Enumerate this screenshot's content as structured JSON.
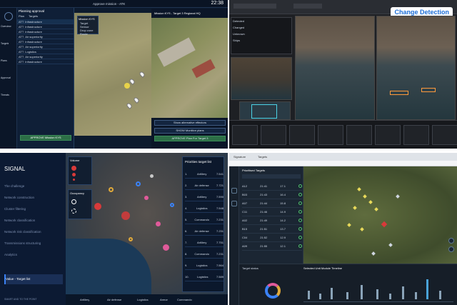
{
  "q1": {
    "top_title": "Approve mission - ATK",
    "time": "22:38",
    "panel_title": "Planning approval",
    "tabs": [
      "Plan",
      "Targets"
    ],
    "side_items": [
      "Overview",
      "Targets",
      "Plans",
      "Approval",
      "Threats"
    ],
    "rows": [
      {
        "id": "ATT",
        "text": "Infrastructure"
      },
      {
        "id": "ATT",
        "text": "Infrastructure"
      },
      {
        "id": "ATT",
        "text": "Infrastructure"
      },
      {
        "id": "ATT",
        "text": "Air superiority"
      },
      {
        "id": "ATT",
        "text": "Infrastructure"
      },
      {
        "id": "ATT",
        "text": "Air superiority"
      },
      {
        "id": "ATT",
        "text": "Logistics"
      },
      {
        "id": "ATT",
        "text": "Air superiority"
      },
      {
        "id": "ATT",
        "text": "Infrastructure"
      }
    ],
    "map_legend_title": "Mission KYS",
    "map_legend": [
      "Target",
      "Sensor",
      "Drop zone",
      "Route"
    ],
    "map2_title": "Mission KYS - Target 3 Regional HQ",
    "btn_show_alt": "Show alternative effectors",
    "btn_show_munitions": "SHOW Munition plans",
    "btn_approve": "APPROVE Plan For Target 3",
    "btn_approve_left": "APPROVE Mission KYS"
  },
  "q2": {
    "badge": "Change Detection",
    "panel_rows": [
      "Detected",
      "Changed",
      "Unknown",
      "Ships"
    ]
  },
  "q3": {
    "logo": "SIGNAL",
    "menu": [
      "The challenge",
      "Network construction",
      "Cluster filtering",
      "Network classification",
      "Network risk classification",
      "Transmissions structuring",
      "Analytics",
      "Value - Target list"
    ],
    "active_menu": "Value - Target list",
    "footer_link": "SMART AND TO THE POINT",
    "legend1_title": "Volume",
    "legend2_title": "Occupancy",
    "prio_title": "Priorities target list",
    "prio": [
      {
        "rank": "1.",
        "name": "Artillery",
        "val": "7.541"
      },
      {
        "rank": "2.",
        "name": "Air defense",
        "val": "7.721"
      },
      {
        "rank": "3.",
        "name": "Artillery",
        "val": "7.590"
      },
      {
        "rank": "4.",
        "name": "Logistics",
        "val": "7.548"
      },
      {
        "rank": "5.",
        "name": "Commando",
        "val": "7.231"
      },
      {
        "rank": "6.",
        "name": "Air defense",
        "val": "7.231"
      },
      {
        "rank": "7.",
        "name": "Artillery",
        "val": "7.751"
      },
      {
        "rank": "8.",
        "name": "Commando",
        "val": "7.231"
      },
      {
        "rank": "9.",
        "name": "Logistics",
        "val": "7.564"
      },
      {
        "rank": "10.",
        "name": "Logistics",
        "val": "7.589"
      }
    ],
    "bottom_legend": [
      "Artillery",
      "Air defense",
      "Logistics",
      "Armor",
      "Commando"
    ],
    "colors": {
      "artillery": "#e0a93a",
      "airdef": "#3b82f6",
      "logistics": "#e05a9a",
      "armor": "#c8c8c8",
      "commando": "#d83a3a"
    }
  },
  "q4": {
    "tabs": [
      "Signature",
      "Targets"
    ],
    "panel_title": "Prioritised Targets",
    "rows": [
      {
        "a": "A12",
        "b": "21:41",
        "c": "17.1"
      },
      {
        "a": "B03",
        "b": "21:43",
        "c": "16.4"
      },
      {
        "a": "A07",
        "b": "21:44",
        "c": "15.8"
      },
      {
        "a": "C11",
        "b": "21:46",
        "c": "14.9"
      },
      {
        "a": "A02",
        "b": "21:49",
        "c": "14.2"
      },
      {
        "a": "B15",
        "b": "21:51",
        "c": "13.7"
      },
      {
        "a": "C04",
        "b": "21:52",
        "c": "12.9"
      },
      {
        "a": "A09",
        "b": "21:55",
        "c": "12.1"
      }
    ],
    "timeline_title": "Selected Unit Module Timeline",
    "sub_title": "Target status"
  }
}
